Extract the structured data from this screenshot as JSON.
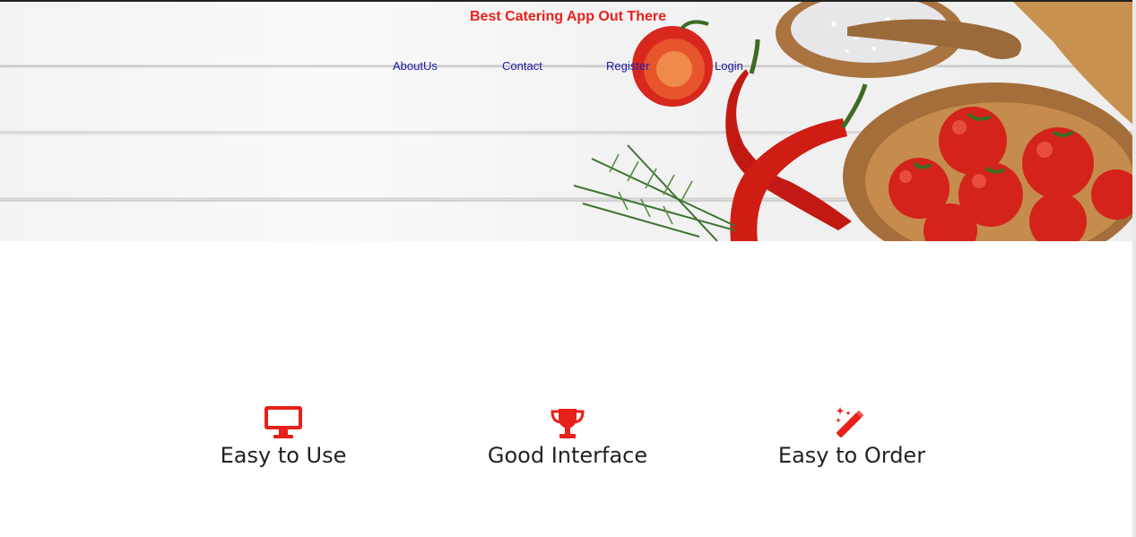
{
  "header": {
    "brand_title": "Best Catering App Out There",
    "nav": [
      "AboutUs",
      "Contact",
      "Register",
      "Login"
    ],
    "hero_image": "food-ingredients-on-white-wood"
  },
  "features": [
    {
      "icon": "monitor-icon",
      "label": "Easy to Use"
    },
    {
      "icon": "trophy-icon",
      "label": "Good Interface"
    },
    {
      "icon": "magic-wand-icon",
      "label": "Easy to Order"
    }
  ],
  "colors": {
    "accent": "#e8201a",
    "nav_link": "#1a1aa8",
    "text": "#222222"
  }
}
